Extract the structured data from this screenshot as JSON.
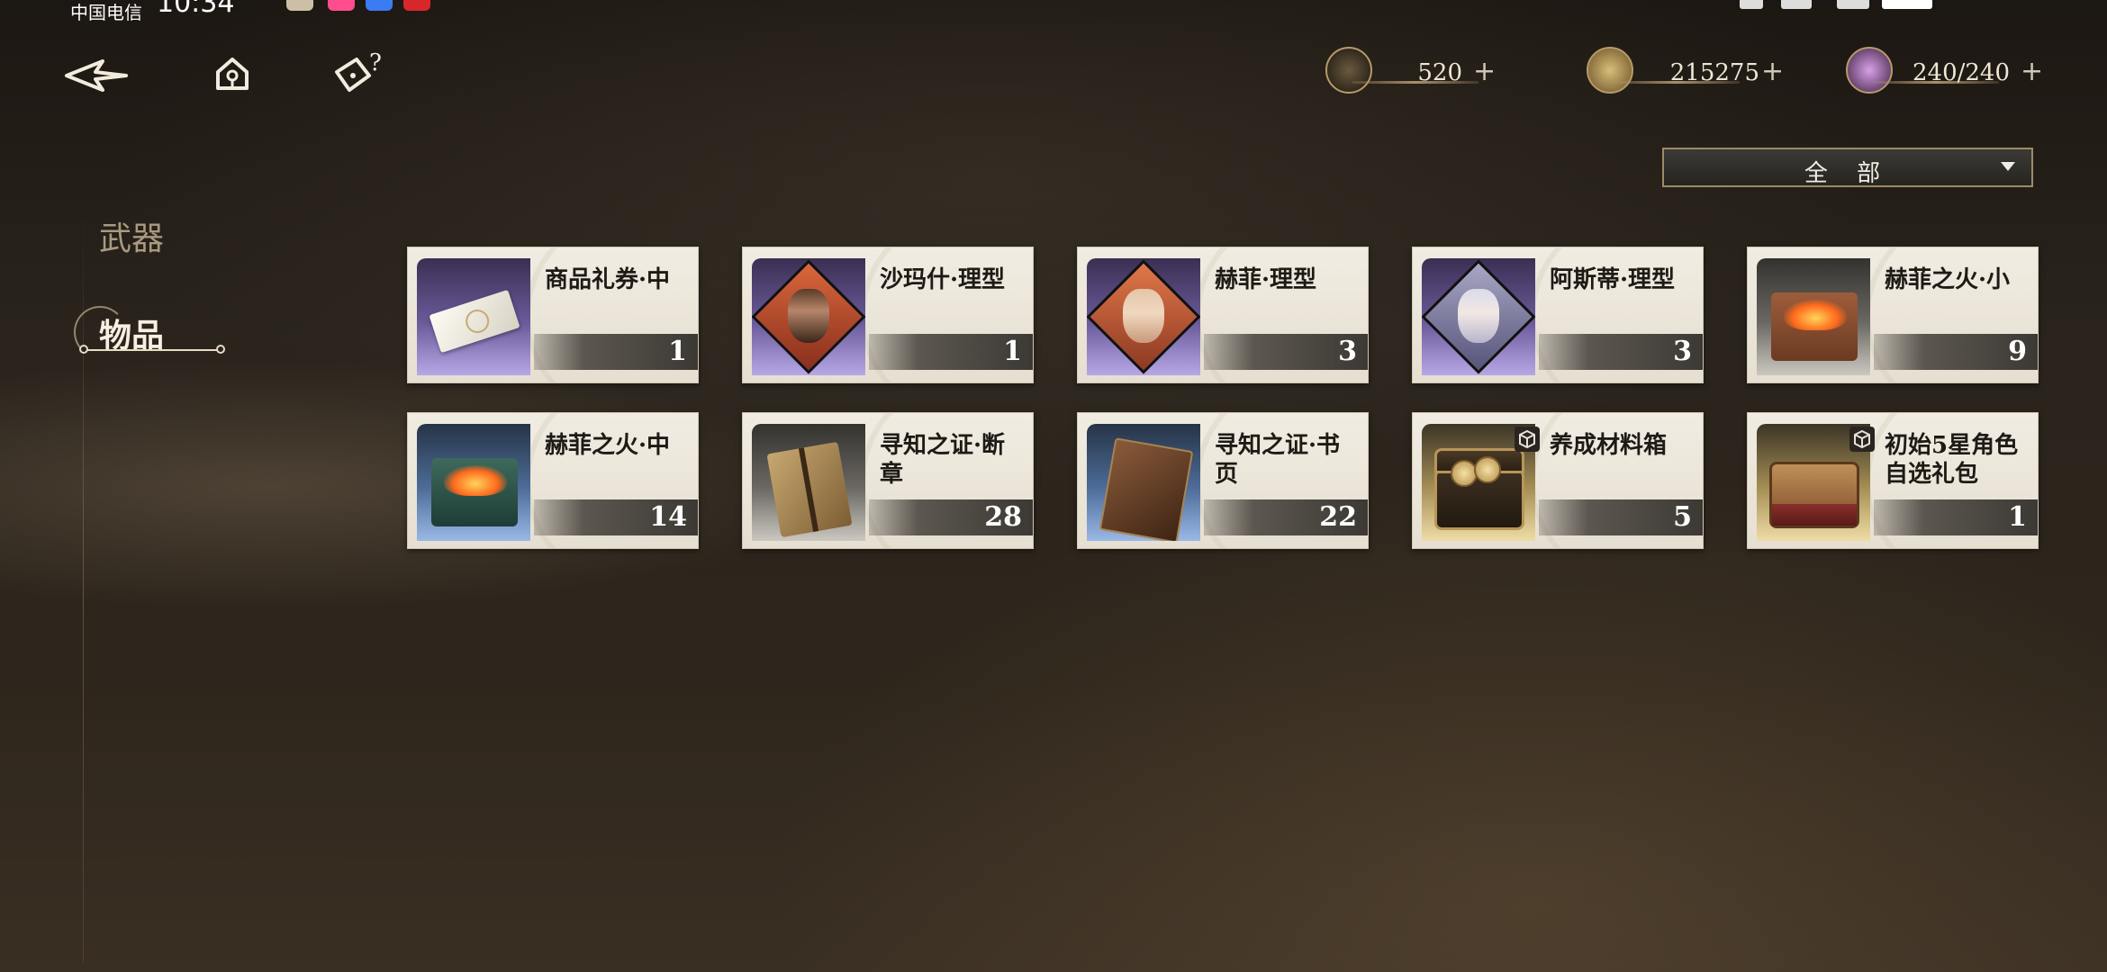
{
  "status_bar": {
    "carrier": "中国电信",
    "time": "10:34"
  },
  "top_nav": {
    "back_icon": "back-arrow-icon",
    "home_icon": "home-icon",
    "help_icon": "help-icon"
  },
  "currencies": [
    {
      "icon": "quill-currency-icon",
      "value": "520"
    },
    {
      "icon": "gold-coin-icon",
      "value": "215275"
    },
    {
      "icon": "lantern-stamina-icon",
      "value": "240/240"
    }
  ],
  "filter": {
    "selected": "全 部"
  },
  "sidebar": {
    "items": [
      {
        "label": "武器",
        "selected": false
      },
      {
        "label": "物品",
        "selected": true
      }
    ]
  },
  "items": [
    {
      "name": "商品礼券·中",
      "count": "1",
      "rarity": "purple"
    },
    {
      "name": "沙玛什·理型",
      "count": "1",
      "rarity": "purple"
    },
    {
      "name": "赫菲·理型",
      "count": "3",
      "rarity": "purple"
    },
    {
      "name": "阿斯蒂·理型",
      "count": "3",
      "rarity": "purple"
    },
    {
      "name": "赫菲之火·小",
      "count": "9",
      "rarity": "gray"
    },
    {
      "name": "赫菲之火·中",
      "count": "14",
      "rarity": "blue"
    },
    {
      "name": "寻知之证·断章",
      "count": "28",
      "rarity": "gray"
    },
    {
      "name": "寻知之证·书页",
      "count": "22",
      "rarity": "blue"
    },
    {
      "name": "养成材料箱",
      "count": "5",
      "rarity": "gold"
    },
    {
      "name": "初始5星角色自选礼包",
      "count": "1",
      "rarity": "gold"
    }
  ],
  "colors": {
    "purple": "#8f7fc8",
    "blue": "#7c9dd4",
    "gray": "#a8a49e",
    "gold": "#e6d194"
  }
}
